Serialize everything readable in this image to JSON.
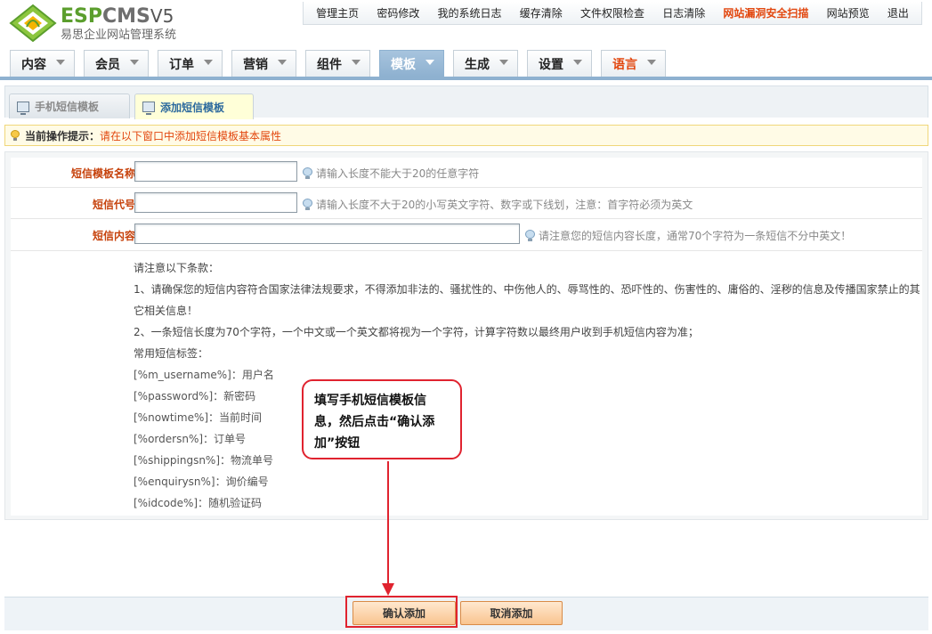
{
  "brand": {
    "logo_esp": "ESP",
    "logo_cms": "CMS",
    "logo_version": "V5",
    "subtitle": "易思企业网站管理系统"
  },
  "top_links": [
    "管理主页",
    "密码修改",
    "我的系统日志",
    "缓存清除",
    "文件权限检查",
    "日志清除",
    "网站漏洞安全扫描",
    "网站预览",
    "退出"
  ],
  "nav": {
    "tabs": [
      {
        "label": "内容"
      },
      {
        "label": "会员"
      },
      {
        "label": "订单"
      },
      {
        "label": "营销"
      },
      {
        "label": "组件"
      },
      {
        "label": "模板"
      },
      {
        "label": "生成"
      },
      {
        "label": "设置"
      },
      {
        "label": "语言"
      }
    ],
    "active": "模板"
  },
  "sub_tabs": [
    {
      "label": "手机短信模板"
    },
    {
      "label": "添加短信模板"
    }
  ],
  "tip": {
    "label": "当前操作提示：",
    "text": "请在以下窗口中添加短信模板基本属性"
  },
  "form": {
    "name_label": "短信模板名称",
    "name_value": "",
    "name_hint": "请输入长度不能大于20的任意字符",
    "code_label": "短信代号",
    "code_value": "",
    "code_hint": "请输入长度不大于20的小写英文字符、数字或下线划，注意：首字符必须为英文",
    "content_label": "短信内容",
    "content_value": "",
    "content_hint": "请注意您的短信内容长度，通常70个字符为一条短信不分中英文！"
  },
  "notes": {
    "title": "请注意以下条款：",
    "item1": "1、请确保您的短信内容符合国家法律法规要求，不得添加非法的、骚扰性的、中伤他人的、辱骂性的、恐吓性的、伤害性的、庸俗的、淫秽的信息及传播国家禁止的其它相关信息！",
    "item2": "2、一条短信长度为70个字符，一个中文或一个英文都将视为一个字符，计算字符数以最终用户收到手机短信内容为准；",
    "tags_title": "常用短信标签：",
    "tags": [
      "[%m_username%]：用户名",
      "[%password%]：新密码",
      "[%nowtime%]：当前时间",
      "[%ordersn%]：订单号",
      "[%shippingsn%]：物流单号",
      "[%enquirysn%]：询价编号",
      "[%idcode%]：随机验证码"
    ]
  },
  "callout": {
    "text": "填写手机短信模板信息，然后点击“确认添加”按钮"
  },
  "buttons": {
    "confirm": "确认添加",
    "cancel": "取消添加"
  },
  "colors": {
    "accent_red": "#e0232f",
    "label_orange": "#c6420c",
    "nav_active": "#8eb1d0"
  }
}
